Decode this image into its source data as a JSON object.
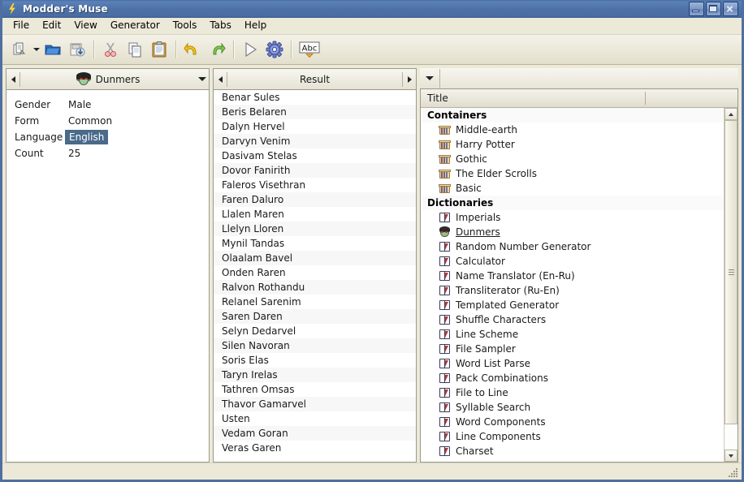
{
  "window": {
    "title": "Modder's Muse",
    "app_icon": "lightning-bolt-icon",
    "buttons": {
      "minimize": "minimize",
      "maximize": "maximize",
      "close": "close"
    }
  },
  "menu": {
    "items": [
      {
        "label": "File",
        "mnemonic": "F"
      },
      {
        "label": "Edit",
        "mnemonic": "E"
      },
      {
        "label": "View",
        "mnemonic": "V"
      },
      {
        "label": "Generator",
        "mnemonic": "G"
      },
      {
        "label": "Tools",
        "mnemonic": "T"
      },
      {
        "label": "Tabs",
        "mnemonic": "b"
      },
      {
        "label": "Help",
        "mnemonic": "H"
      }
    ]
  },
  "toolbar": {
    "items": [
      {
        "name": "new-document-icon",
        "label": "New"
      },
      {
        "name": "dropdown-arrow-icon",
        "label": "New options"
      },
      {
        "name": "open-folder-icon",
        "label": "Open"
      },
      {
        "name": "save-icon",
        "label": "Save"
      },
      {
        "name": "cut-icon",
        "label": "Cut"
      },
      {
        "name": "copy-icon",
        "label": "Copy"
      },
      {
        "name": "paste-icon",
        "label": "Paste"
      },
      {
        "name": "undo-icon",
        "label": "Undo"
      },
      {
        "name": "redo-icon",
        "label": "Redo"
      },
      {
        "name": "run-icon",
        "label": "Run"
      },
      {
        "name": "settings-gear-icon",
        "label": "Settings"
      },
      {
        "name": "spellcheck-abc-icon",
        "label": "Abc"
      }
    ]
  },
  "properties_panel": {
    "title": "Dunmers",
    "icon": "dunmer-face-icon",
    "nav_prev": "◀",
    "dropdown": "▼",
    "rows": [
      {
        "key": "Gender",
        "value": "Male",
        "selected": false
      },
      {
        "key": "Form",
        "value": "Common",
        "selected": false
      },
      {
        "key": "Language",
        "value": "English",
        "selected": true
      },
      {
        "key": "Count",
        "value": "25",
        "selected": false
      }
    ]
  },
  "result_panel": {
    "title": "Result",
    "nav_prev": "◀",
    "nav_next": "▶",
    "items": [
      "Benar Sules",
      "Beris Belaren",
      "Dalyn Hervel",
      "Darvyn Venim",
      "Dasivam Stelas",
      "Dovor Fanirith",
      "Faleros Visethran",
      "Faren Daluro",
      "Llalen Maren",
      "Llelyn Lloren",
      "Mynil Tandas",
      "Olaalam Bavel",
      "Onden Raren",
      "Ralvon Rothandu",
      "Relanel Sarenim",
      "Saren Daren",
      "Selyn Dedarvel",
      "Silen Navoran",
      "Soris Elas",
      "Taryn Irelas",
      "Tathren Omsas",
      "Thavor Gamarvel",
      "Usten",
      "Vedam Goran",
      "Veras Garen"
    ]
  },
  "tree_panel": {
    "dropdown": "▼",
    "column_header": "Title",
    "groups": [
      {
        "label": "Containers",
        "items": [
          {
            "label": "Middle-earth",
            "icon": "container-crate-icon",
            "active": false
          },
          {
            "label": "Harry Potter",
            "icon": "container-crate-icon",
            "active": false
          },
          {
            "label": "Gothic",
            "icon": "container-crate-icon",
            "active": false
          },
          {
            "label": "The Elder Scrolls",
            "icon": "container-crate-icon",
            "active": false
          },
          {
            "label": "Basic",
            "icon": "container-crate-icon",
            "active": false
          }
        ]
      },
      {
        "label": "Dictionaries",
        "items": [
          {
            "label": "Imperials",
            "icon": "book-icon",
            "active": false
          },
          {
            "label": "Dunmers",
            "icon": "dunmer-face-icon",
            "active": true
          },
          {
            "label": "Random Number Generator",
            "icon": "book-icon",
            "active": false
          },
          {
            "label": "Calculator",
            "icon": "book-icon",
            "active": false
          },
          {
            "label": "Name Translator (En-Ru)",
            "icon": "book-icon",
            "active": false
          },
          {
            "label": "Transliterator (Ru-En)",
            "icon": "book-icon",
            "active": false
          },
          {
            "label": "Templated Generator",
            "icon": "book-icon",
            "active": false
          },
          {
            "label": "Shuffle Characters",
            "icon": "book-icon",
            "active": false
          },
          {
            "label": "Line Scheme",
            "icon": "book-icon",
            "active": false
          },
          {
            "label": "File Sampler",
            "icon": "book-icon",
            "active": false
          },
          {
            "label": "Word List Parse",
            "icon": "book-icon",
            "active": false
          },
          {
            "label": "Pack Combinations",
            "icon": "book-icon",
            "active": false
          },
          {
            "label": "File to Line",
            "icon": "book-icon",
            "active": false
          },
          {
            "label": "Syllable Search",
            "icon": "book-icon",
            "active": false
          },
          {
            "label": "Word Components",
            "icon": "book-icon",
            "active": false
          },
          {
            "label": "Line Components",
            "icon": "book-icon",
            "active": false
          },
          {
            "label": "Charset",
            "icon": "book-icon",
            "active": false
          }
        ]
      }
    ]
  },
  "colors": {
    "titlebar": "#4e72a8",
    "window_border": "#4f6fa0",
    "chrome": "#ece9d8",
    "selection": "#4a6a8a",
    "selection_text": "#ffffff",
    "list_stripe": "#f7f7f7"
  }
}
